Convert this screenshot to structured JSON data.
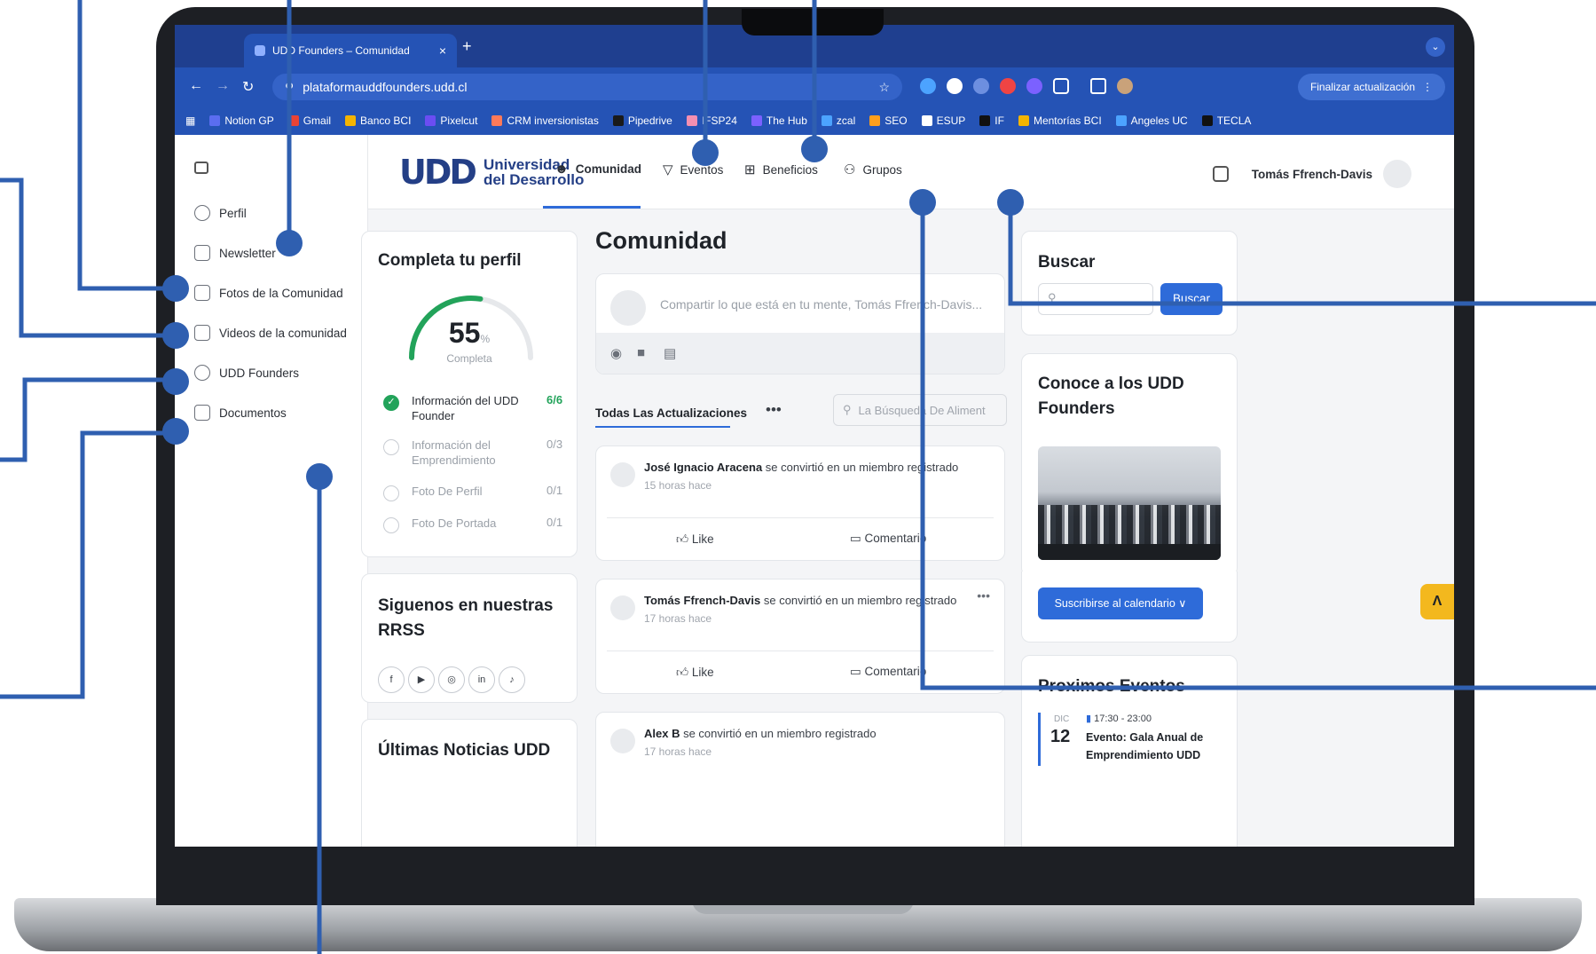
{
  "browser": {
    "tab_title": "UDD Founders – Comunidad",
    "tab_close": "×",
    "new_tab": "+",
    "url": "plataformauddfounders.udd.cl",
    "update_button": "Finalizar actualización",
    "bookmarks": [
      {
        "label": "Notion GP",
        "color": "#5b6df0"
      },
      {
        "label": "Gmail",
        "color": "#ea4335"
      },
      {
        "label": "Banco BCI",
        "color": "#f4b400"
      },
      {
        "label": "Pixelcut",
        "color": "#6b4df2"
      },
      {
        "label": "CRM inversionistas",
        "color": "#ff7a59"
      },
      {
        "label": "Pipedrive",
        "color": "#1a1a1a"
      },
      {
        "label": "IFSP24",
        "color": "#f48fb1"
      },
      {
        "label": "The Hub",
        "color": "#7b61ff"
      },
      {
        "label": "zcal",
        "color": "#4ca3ff"
      },
      {
        "label": "SEO",
        "color": "#ff9f1c"
      },
      {
        "label": "ESUP",
        "color": "#ffffff"
      },
      {
        "label": "IF",
        "color": "#111111"
      },
      {
        "label": "Mentorías BCI",
        "color": "#f4b400"
      },
      {
        "label": "Angeles UC",
        "color": "#4ca3ff"
      },
      {
        "label": "TECLA",
        "color": "#111111"
      }
    ]
  },
  "sidebar": {
    "items": [
      {
        "label": "Perfil"
      },
      {
        "label": "Newsletter"
      },
      {
        "label": "Fotos de la Comunidad"
      },
      {
        "label": "Videos de la comunidad"
      },
      {
        "label": "UDD Founders"
      },
      {
        "label": "Documentos"
      }
    ]
  },
  "header": {
    "logo_mark": "UDD",
    "logo_line1": "Universidad",
    "logo_line2": "del Desarrollo",
    "nav": [
      {
        "label": "Comunidad",
        "icon": "smiley-icon",
        "glyph": "☻"
      },
      {
        "label": "Eventos",
        "icon": "filter-icon",
        "glyph": "▽"
      },
      {
        "label": "Beneficios",
        "icon": "gift-icon",
        "glyph": "⊞"
      },
      {
        "label": "Grupos",
        "icon": "group-icon",
        "glyph": "⚇"
      }
    ],
    "user_name": "Tomás Ffrench-Davis"
  },
  "profile_card": {
    "title": "Completa tu perfil",
    "percent": "55",
    "percent_unit": "%",
    "percent_label": "Completa",
    "progress": 0.55,
    "steps": [
      {
        "label": "Información del UDD Founder",
        "count": "6/6",
        "done": true
      },
      {
        "label": "Información del Emprendimiento",
        "count": "0/3",
        "done": false
      },
      {
        "label": "Foto De Perfil",
        "count": "0/1",
        "done": false
      },
      {
        "label": "Foto De Portada",
        "count": "0/1",
        "done": false
      }
    ]
  },
  "social_card": {
    "title": "Siguenos en nuestras RRSS",
    "icons": [
      {
        "name": "facebook-icon",
        "glyph": "f"
      },
      {
        "name": "youtube-icon",
        "glyph": "▶"
      },
      {
        "name": "instagram-icon",
        "glyph": "◎"
      },
      {
        "name": "linkedin-icon",
        "glyph": "in"
      },
      {
        "name": "tiktok-icon",
        "glyph": "♪"
      }
    ]
  },
  "news_card": {
    "title": "Últimas Noticias UDD"
  },
  "feed": {
    "title": "Comunidad",
    "composer_placeholder": "Compartir lo que está en tu mente, Tomás Ffrench-Davis...",
    "tab_active": "Todas Las Actualizaciones",
    "more": "•••",
    "search_placeholder": "La Búsqueda De Aliment",
    "like": "Like",
    "comment": "Comentario",
    "posts": [
      {
        "name": "José Ignacio Aracena",
        "text": " se convirtió en un miembro registrado",
        "time": "15 horas hace"
      },
      {
        "name": "Tomás Ffrench-Davis",
        "text": " se convirtió en un miembro registrado",
        "time": "17 horas hace"
      },
      {
        "name": "Alex B",
        "text": " se convirtió en un miembro registrado",
        "time": "17 horas hace"
      }
    ]
  },
  "search_card": {
    "title": "Buscar",
    "button": "Buscar"
  },
  "founders_card": {
    "title": "Conoce a los UDD Founders"
  },
  "calendar_button": "Suscribirse al calendario ∨",
  "events_card": {
    "title": "Proximos Eventos",
    "month": "DIC",
    "day": "12",
    "time": "17:30 - 23:00",
    "event_title": "Evento: Gala Anual de Emprendimiento UDD"
  },
  "fab_label": "Ʌ"
}
